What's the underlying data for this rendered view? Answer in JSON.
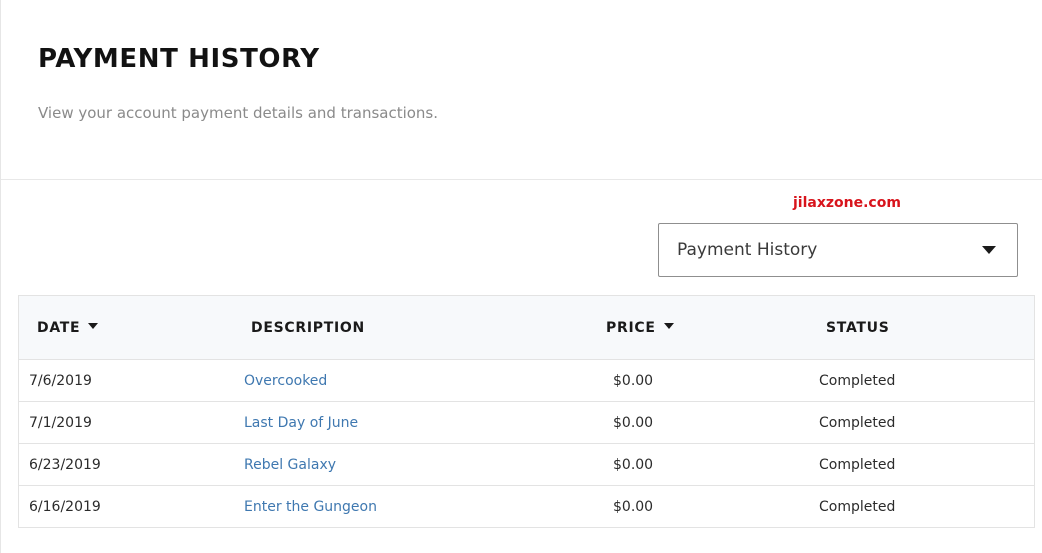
{
  "header": {
    "title": "PAYMENT HISTORY",
    "subtitle": "View your account payment details and transactions."
  },
  "watermark": "jilaxzone.com",
  "filter": {
    "selected": "Payment History"
  },
  "table": {
    "columns": {
      "date": "DATE",
      "description": "DESCRIPTION",
      "price": "PRICE",
      "status": "STATUS"
    },
    "rows": [
      {
        "date": "7/6/2019",
        "description": "Overcooked",
        "price": "$0.00",
        "status": "Completed"
      },
      {
        "date": "7/1/2019",
        "description": "Last Day of June",
        "price": "$0.00",
        "status": "Completed"
      },
      {
        "date": "6/23/2019",
        "description": "Rebel Galaxy",
        "price": "$0.00",
        "status": "Completed"
      },
      {
        "date": "6/16/2019",
        "description": "Enter the Gungeon",
        "price": "$0.00",
        "status": "Completed"
      }
    ]
  },
  "colors": {
    "link": "#3f78b0",
    "watermark": "#d8141c",
    "header_bg": "#f7f9fb"
  }
}
